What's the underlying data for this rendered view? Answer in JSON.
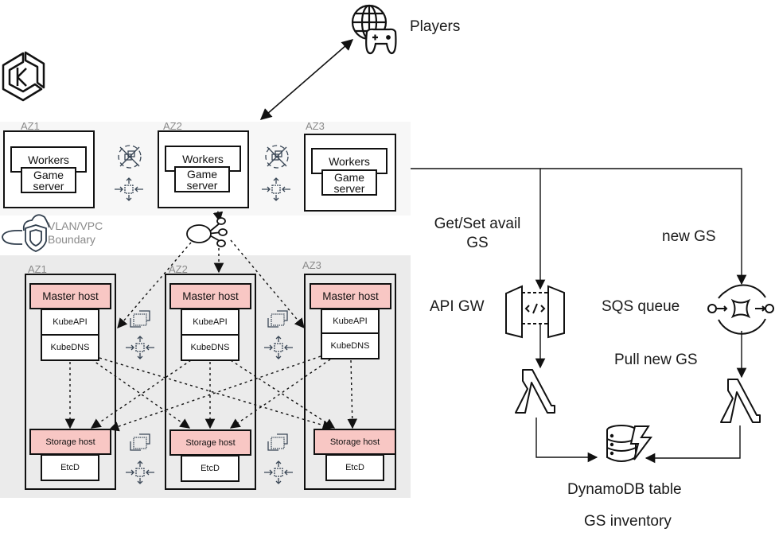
{
  "players": {
    "label": "Players",
    "icon": "globe-gamepad-icon"
  },
  "kubernetes": {
    "icon": "kubernetes-icon"
  },
  "worker_band": {
    "zones": [
      {
        "az": "AZ1",
        "workers": "Workers",
        "game_server": "Game\nserver"
      },
      {
        "az": "AZ2",
        "workers": "Workers",
        "game_server": "Game\nserver"
      },
      {
        "az": "AZ3",
        "workers": "Workers",
        "game_server": "Game\nserver"
      }
    ],
    "boundary_label": "VLAN/VPC\nBoundary"
  },
  "control_band": {
    "zones": [
      {
        "az": "AZ1",
        "master": "Master host",
        "kubeapi": "KubeAPI",
        "kubedns": "KubeDNS",
        "storage": "Storage host",
        "etcd": "EtcD"
      },
      {
        "az": "AZ2",
        "master": "Master host",
        "kubeapi": "KubeAPI",
        "kubedns": "KubeDNS",
        "storage": "Storage host",
        "etcd": "EtcD"
      },
      {
        "az": "AZ3",
        "master": "Master host",
        "kubeapi": "KubeAPI",
        "kubedns": "KubeDNS",
        "storage": "Storage host",
        "etcd": "EtcD"
      }
    ]
  },
  "serverless": {
    "get_set_label": "Get/Set avail\nGS",
    "new_gs_label": "new GS",
    "api_gw_label": "API GW",
    "sqs_label": "SQS queue",
    "pull_label": "Pull new GS",
    "dynamo_label": "DynamoDB table",
    "inventory_label": "GS inventory"
  }
}
